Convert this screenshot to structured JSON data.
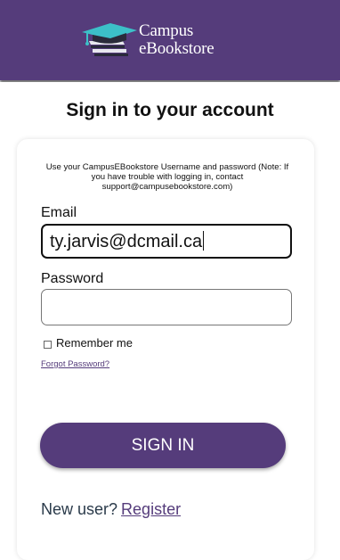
{
  "header": {
    "logo_line1": "Campus",
    "logo_line2": "eBookstore",
    "logo_icon": "graduation-cap-books-icon",
    "bg_color": "#553c7b"
  },
  "page": {
    "title": "Sign in to your account"
  },
  "form": {
    "notice": "Use your CampusEBookstore Username and password (Note: If you have trouble with logging in, contact support@campusebookstore.com)",
    "email_label": "Email",
    "email_value": "ty.jarvis@dcmail.ca",
    "password_label": "Password",
    "password_value": "",
    "remember_label": "Remember me",
    "forgot_label": "Forgot Password?",
    "signin_label": "SIGN IN",
    "newuser_text": "New user?",
    "register_label": "Register",
    "accent_color": "#553c7b"
  }
}
